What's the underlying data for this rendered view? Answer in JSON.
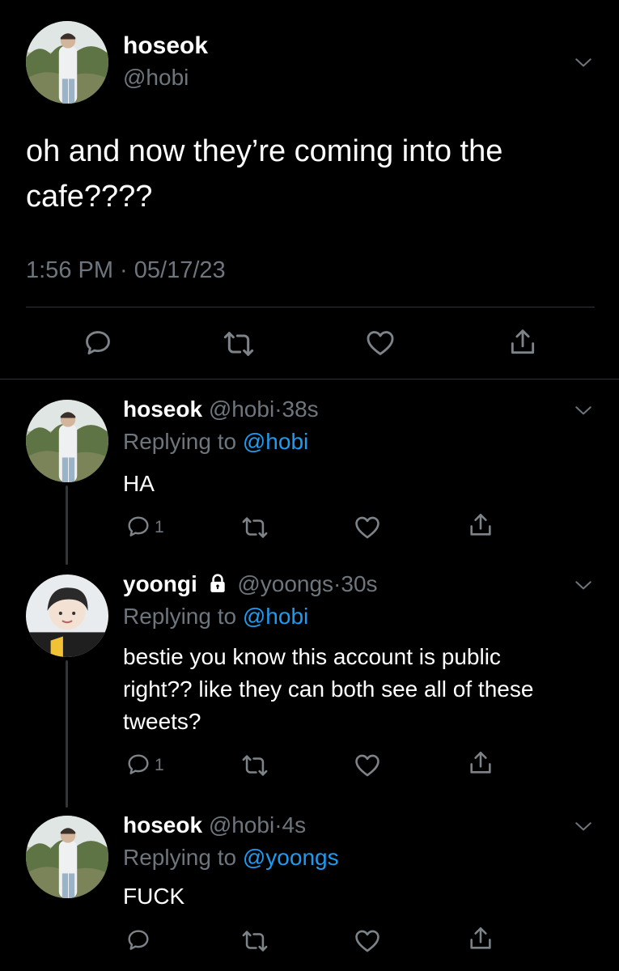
{
  "main_tweet": {
    "display_name": "hoseok",
    "handle": "@hobi",
    "text_line1": "oh and now they’re coming into the",
    "text_line2": "cafe????",
    "timestamp": "1:56 PM · 05/17/23",
    "actions": [
      "reply-icon",
      "retweet-icon",
      "like-icon",
      "share-icon"
    ]
  },
  "replies": [
    {
      "display_name": "hoseok",
      "handle": "@hobi",
      "dot": "·",
      "time": "38s",
      "replying_prefix": "Replying to",
      "replying_handle": "@hobi",
      "text_lines": [
        "HA"
      ],
      "reply_count": "1"
    },
    {
      "display_name": "yoongi",
      "locked": true,
      "handle": "@yoongs",
      "dot": "·",
      "time": "30s",
      "replying_prefix": "Replying to",
      "replying_handle": "@hobi",
      "text_lines": [
        "bestie you know this account is public",
        "right?? like they can both see all of these",
        "tweets?"
      ],
      "reply_count": "1"
    },
    {
      "display_name": "hoseok",
      "handle": "@hobi",
      "dot": "·",
      "time": "4s",
      "replying_prefix": "Replying to",
      "replying_handle": "@yoongs",
      "text_lines": [
        "FUCK"
      ],
      "reply_count": ""
    }
  ],
  "colors": {
    "background": "#000000",
    "text": "#e7e9ea",
    "muted": "#6e767d",
    "link": "#1d9bf0",
    "divider": "#2f3336"
  }
}
